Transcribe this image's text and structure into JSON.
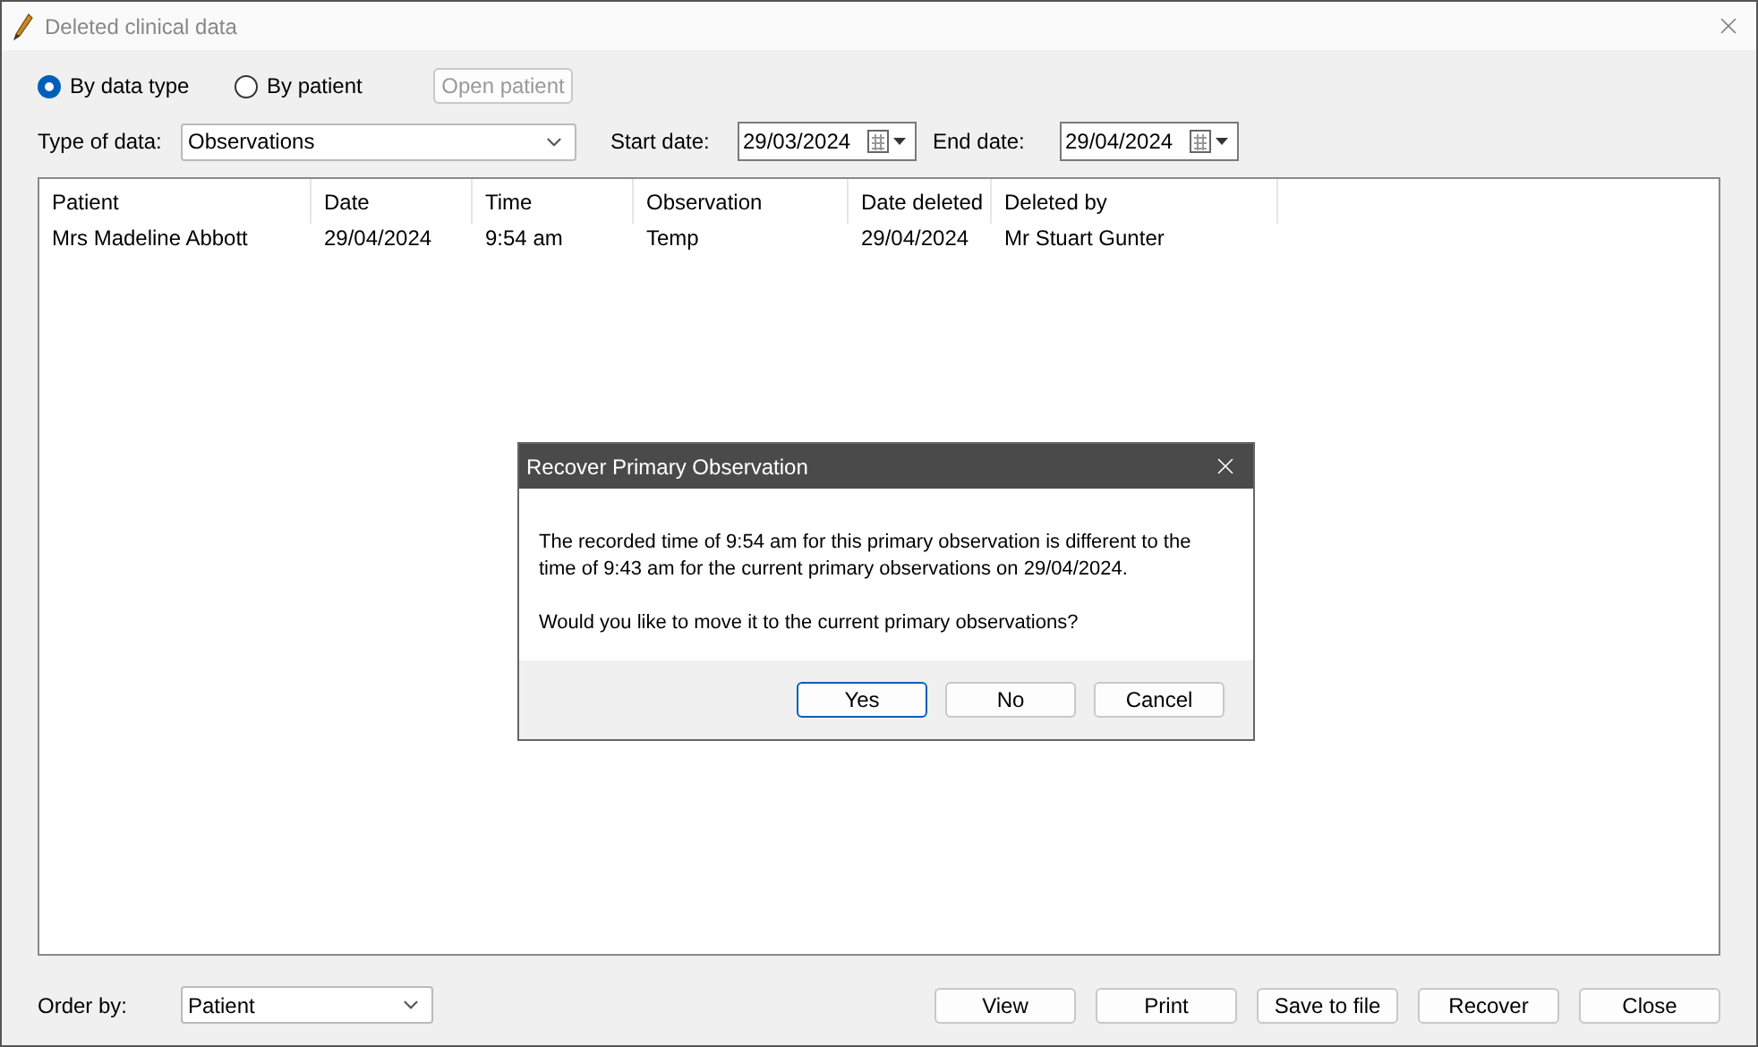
{
  "window": {
    "title": "Deleted clinical data"
  },
  "mode_options": [
    {
      "label": "By data type",
      "selected": true
    },
    {
      "label": "By patient",
      "selected": false
    }
  ],
  "open_patient_button": {
    "label": "Open patient",
    "disabled": true
  },
  "filters": {
    "type_label": "Type of data:",
    "type_value": "Observations",
    "start_label": "Start date:",
    "start_value": "29/03/2024",
    "end_label": "End date:",
    "end_value": "29/04/2024"
  },
  "table": {
    "columns": [
      "Patient",
      "Date",
      "Time",
      "Observation",
      "Date deleted",
      "Deleted by"
    ],
    "rows": [
      [
        "Mrs Madeline Abbott",
        "29/04/2024",
        "9:54 am",
        "Temp",
        "29/04/2024",
        "Mr Stuart Gunter"
      ]
    ]
  },
  "order_by": {
    "label": "Order by:",
    "value": "Patient"
  },
  "buttons": [
    "View",
    "Print",
    "Save to file",
    "Recover",
    "Close"
  ],
  "dialog": {
    "title": "Recover Primary Observation",
    "message": "The recorded time of 9:54 am for this primary observation is different to the time of 9:43 am for the current primary observations on 29/04/2024.",
    "question": "Would you like to move it to the current primary observations?",
    "buttons": [
      {
        "label": "Yes",
        "default": true
      },
      {
        "label": "No",
        "default": false
      },
      {
        "label": "Cancel",
        "default": false
      }
    ]
  }
}
